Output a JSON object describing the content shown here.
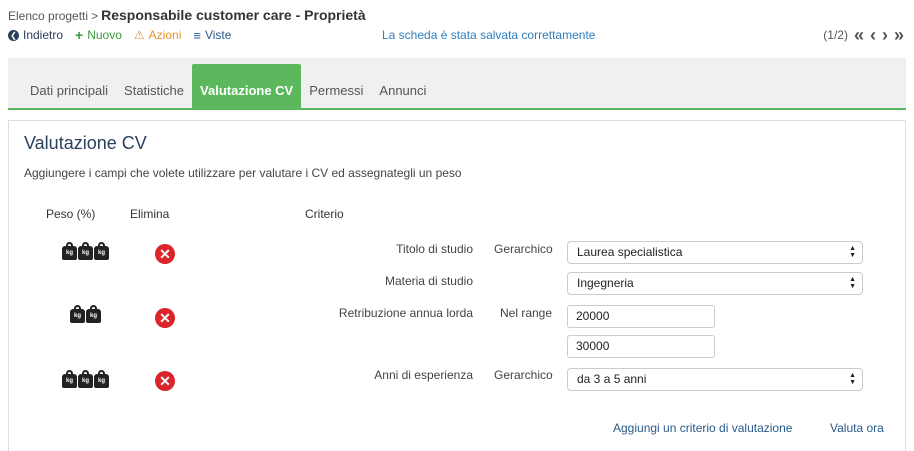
{
  "breadcrumb": {
    "parent": "Elenco progetti",
    "separator": ">",
    "current": "Responsabile customer care - Proprietà"
  },
  "toolbar": {
    "back": "Indietro",
    "new": "Nuovo",
    "actions": "Azioni",
    "views": "Viste"
  },
  "status_message": "La scheda è stata salvata correttamente",
  "pager": {
    "position": "(1/2)"
  },
  "tabs": [
    {
      "label": "Dati principali"
    },
    {
      "label": "Statistiche"
    },
    {
      "label": "Valutazione CV",
      "active": true
    },
    {
      "label": "Permessi"
    },
    {
      "label": "Annunci"
    }
  ],
  "panel": {
    "title": "Valutazione CV",
    "description": "Aggiungere i campi che volete utilizzare per valutare i CV ed assegnategli un peso",
    "headers": {
      "weight": "Peso (%)",
      "delete": "Elimina",
      "criterion": "Criterio"
    },
    "weight_unit": "kg",
    "criteria": [
      {
        "weight": 3,
        "label": "Titolo di studio",
        "mode": "Gerarchico",
        "value": "Laurea specialistica"
      },
      {
        "label": "Materia di studio",
        "mode": "",
        "value": "Ingegneria"
      },
      {
        "weight": 2,
        "label": "Retribuzione annua lorda",
        "mode": "Nel range",
        "min": "20000",
        "max": "30000"
      },
      {
        "weight": 3,
        "label": "Anni di esperienza",
        "mode": "Gerarchico",
        "value": "da 3 a 5 anni"
      }
    ],
    "add_link": "Aggiungi un criterio di valutazione",
    "evaluate_link": "Valuta ora"
  },
  "colors": {
    "accent_green": "#5cb85c",
    "delete_red": "#d9252b",
    "link_blue": "#2f7fbf"
  }
}
